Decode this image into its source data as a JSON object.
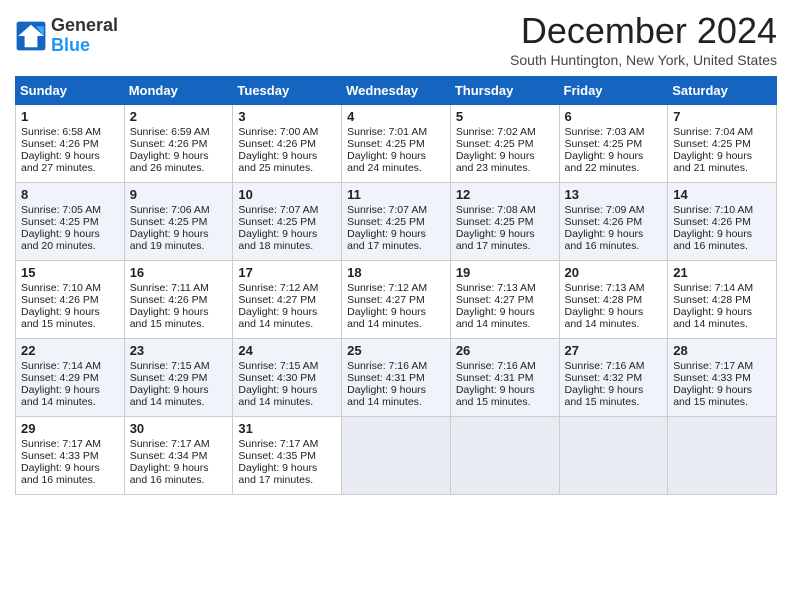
{
  "header": {
    "logo_line1": "General",
    "logo_line2": "Blue",
    "title": "December 2024",
    "subtitle": "South Huntington, New York, United States"
  },
  "columns": [
    "Sunday",
    "Monday",
    "Tuesday",
    "Wednesday",
    "Thursday",
    "Friday",
    "Saturday"
  ],
  "weeks": [
    [
      {
        "day": "1",
        "lines": [
          "Sunrise: 6:58 AM",
          "Sunset: 4:26 PM",
          "Daylight: 9 hours",
          "and 27 minutes."
        ]
      },
      {
        "day": "2",
        "lines": [
          "Sunrise: 6:59 AM",
          "Sunset: 4:26 PM",
          "Daylight: 9 hours",
          "and 26 minutes."
        ]
      },
      {
        "day": "3",
        "lines": [
          "Sunrise: 7:00 AM",
          "Sunset: 4:26 PM",
          "Daylight: 9 hours",
          "and 25 minutes."
        ]
      },
      {
        "day": "4",
        "lines": [
          "Sunrise: 7:01 AM",
          "Sunset: 4:25 PM",
          "Daylight: 9 hours",
          "and 24 minutes."
        ]
      },
      {
        "day": "5",
        "lines": [
          "Sunrise: 7:02 AM",
          "Sunset: 4:25 PM",
          "Daylight: 9 hours",
          "and 23 minutes."
        ]
      },
      {
        "day": "6",
        "lines": [
          "Sunrise: 7:03 AM",
          "Sunset: 4:25 PM",
          "Daylight: 9 hours",
          "and 22 minutes."
        ]
      },
      {
        "day": "7",
        "lines": [
          "Sunrise: 7:04 AM",
          "Sunset: 4:25 PM",
          "Daylight: 9 hours",
          "and 21 minutes."
        ]
      }
    ],
    [
      {
        "day": "8",
        "lines": [
          "Sunrise: 7:05 AM",
          "Sunset: 4:25 PM",
          "Daylight: 9 hours",
          "and 20 minutes."
        ]
      },
      {
        "day": "9",
        "lines": [
          "Sunrise: 7:06 AM",
          "Sunset: 4:25 PM",
          "Daylight: 9 hours",
          "and 19 minutes."
        ]
      },
      {
        "day": "10",
        "lines": [
          "Sunrise: 7:07 AM",
          "Sunset: 4:25 PM",
          "Daylight: 9 hours",
          "and 18 minutes."
        ]
      },
      {
        "day": "11",
        "lines": [
          "Sunrise: 7:07 AM",
          "Sunset: 4:25 PM",
          "Daylight: 9 hours",
          "and 17 minutes."
        ]
      },
      {
        "day": "12",
        "lines": [
          "Sunrise: 7:08 AM",
          "Sunset: 4:25 PM",
          "Daylight: 9 hours",
          "and 17 minutes."
        ]
      },
      {
        "day": "13",
        "lines": [
          "Sunrise: 7:09 AM",
          "Sunset: 4:26 PM",
          "Daylight: 9 hours",
          "and 16 minutes."
        ]
      },
      {
        "day": "14",
        "lines": [
          "Sunrise: 7:10 AM",
          "Sunset: 4:26 PM",
          "Daylight: 9 hours",
          "and 16 minutes."
        ]
      }
    ],
    [
      {
        "day": "15",
        "lines": [
          "Sunrise: 7:10 AM",
          "Sunset: 4:26 PM",
          "Daylight: 9 hours",
          "and 15 minutes."
        ]
      },
      {
        "day": "16",
        "lines": [
          "Sunrise: 7:11 AM",
          "Sunset: 4:26 PM",
          "Daylight: 9 hours",
          "and 15 minutes."
        ]
      },
      {
        "day": "17",
        "lines": [
          "Sunrise: 7:12 AM",
          "Sunset: 4:27 PM",
          "Daylight: 9 hours",
          "and 14 minutes."
        ]
      },
      {
        "day": "18",
        "lines": [
          "Sunrise: 7:12 AM",
          "Sunset: 4:27 PM",
          "Daylight: 9 hours",
          "and 14 minutes."
        ]
      },
      {
        "day": "19",
        "lines": [
          "Sunrise: 7:13 AM",
          "Sunset: 4:27 PM",
          "Daylight: 9 hours",
          "and 14 minutes."
        ]
      },
      {
        "day": "20",
        "lines": [
          "Sunrise: 7:13 AM",
          "Sunset: 4:28 PM",
          "Daylight: 9 hours",
          "and 14 minutes."
        ]
      },
      {
        "day": "21",
        "lines": [
          "Sunrise: 7:14 AM",
          "Sunset: 4:28 PM",
          "Daylight: 9 hours",
          "and 14 minutes."
        ]
      }
    ],
    [
      {
        "day": "22",
        "lines": [
          "Sunrise: 7:14 AM",
          "Sunset: 4:29 PM",
          "Daylight: 9 hours",
          "and 14 minutes."
        ]
      },
      {
        "day": "23",
        "lines": [
          "Sunrise: 7:15 AM",
          "Sunset: 4:29 PM",
          "Daylight: 9 hours",
          "and 14 minutes."
        ]
      },
      {
        "day": "24",
        "lines": [
          "Sunrise: 7:15 AM",
          "Sunset: 4:30 PM",
          "Daylight: 9 hours",
          "and 14 minutes."
        ]
      },
      {
        "day": "25",
        "lines": [
          "Sunrise: 7:16 AM",
          "Sunset: 4:31 PM",
          "Daylight: 9 hours",
          "and 14 minutes."
        ]
      },
      {
        "day": "26",
        "lines": [
          "Sunrise: 7:16 AM",
          "Sunset: 4:31 PM",
          "Daylight: 9 hours",
          "and 15 minutes."
        ]
      },
      {
        "day": "27",
        "lines": [
          "Sunrise: 7:16 AM",
          "Sunset: 4:32 PM",
          "Daylight: 9 hours",
          "and 15 minutes."
        ]
      },
      {
        "day": "28",
        "lines": [
          "Sunrise: 7:17 AM",
          "Sunset: 4:33 PM",
          "Daylight: 9 hours",
          "and 15 minutes."
        ]
      }
    ],
    [
      {
        "day": "29",
        "lines": [
          "Sunrise: 7:17 AM",
          "Sunset: 4:33 PM",
          "Daylight: 9 hours",
          "and 16 minutes."
        ]
      },
      {
        "day": "30",
        "lines": [
          "Sunrise: 7:17 AM",
          "Sunset: 4:34 PM",
          "Daylight: 9 hours",
          "and 16 minutes."
        ]
      },
      {
        "day": "31",
        "lines": [
          "Sunrise: 7:17 AM",
          "Sunset: 4:35 PM",
          "Daylight: 9 hours",
          "and 17 minutes."
        ]
      },
      null,
      null,
      null,
      null
    ]
  ]
}
